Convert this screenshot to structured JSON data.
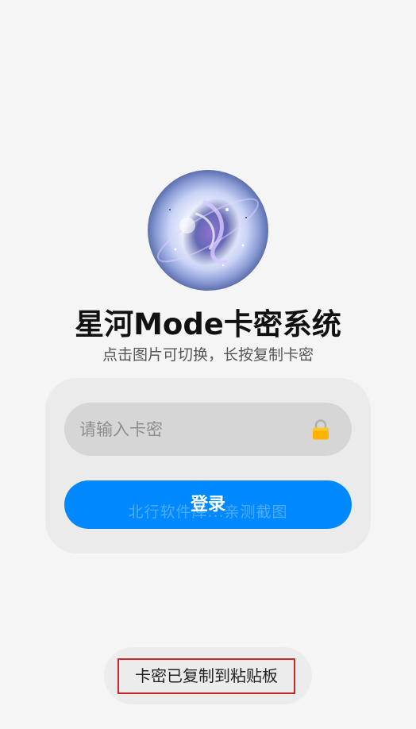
{
  "header": {
    "logo_icon": "galaxy-planet-avatar",
    "title": "星河Mode卡密系统",
    "subtitle": "点击图片可切换，长按复制卡密"
  },
  "form": {
    "card_input": {
      "placeholder": "请输入卡密",
      "value": "",
      "icon": "lock-icon"
    },
    "login_label": "登录"
  },
  "watermark": "北行软件库...亲测截图",
  "toast": {
    "message": "卡密已复制到粘贴板"
  },
  "colors": {
    "background": "#f5f5f5",
    "card": "#ebebeb",
    "input": "#d6d6d6",
    "primary": "#0088ff",
    "toast_highlight": "#c62828"
  }
}
